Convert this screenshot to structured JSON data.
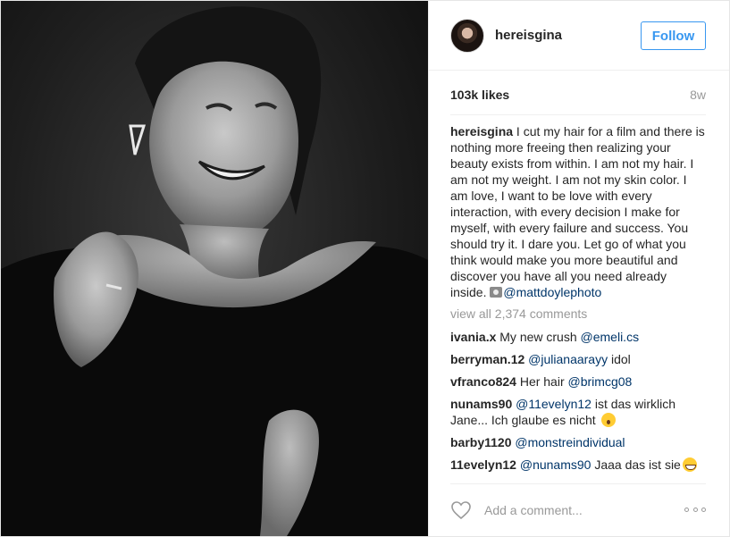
{
  "post": {
    "photo": {
      "alt": "Black and white portrait",
      "tone": "grayscale"
    },
    "header": {
      "username": "hereisgina",
      "follow_label": "Follow"
    },
    "likes": "103k likes",
    "age": "8w",
    "caption": {
      "username": "hereisgina",
      "text": " I cut my hair for a film and there is nothing more freeing then realizing your beauty exists from within. I am not my hair. I am not my weight. I am not my skin color. I am love, I want to be love with every interaction, with every decision I make for myself, with every failure and success. You should try it. I dare you. Let go of what you think would make you more beautiful and discover you have all you need already inside. ",
      "mention": "@mattdoylephoto"
    },
    "view_all": "view all 2,374 comments",
    "comments": [
      {
        "user": "ivania.x",
        "text": " My new crush ",
        "mention": "@emeli.cs",
        "after": ""
      },
      {
        "user": "berryman.12",
        "text": " ",
        "mention": "@julianaarayy",
        "after": " idol"
      },
      {
        "user": "vfranco824",
        "text": " Her hair ",
        "mention": "@brimcg08",
        "after": ""
      },
      {
        "user": "nunams90",
        "text": " ",
        "mention": "@11evelyn12",
        "after": " ist das wirklich Jane... Ich glaube es nicht "
      },
      {
        "user": "barby1120",
        "text": " ",
        "mention": "@monstreindividual",
        "after": ""
      },
      {
        "user": "11evelyn12",
        "text": " ",
        "mention": "@nunams90",
        "after": " Jaaa das ist sie"
      }
    ],
    "footer": {
      "comment_placeholder": "Add a comment..."
    },
    "colors": {
      "accent": "#3897f0",
      "mention": "#003569",
      "muted": "#999999",
      "border": "#efefef"
    },
    "icons": [
      "heart-icon",
      "more-options-icon",
      "camera-emoji-icon",
      "shocked-emoji-icon",
      "grin-emoji-icon"
    ]
  }
}
